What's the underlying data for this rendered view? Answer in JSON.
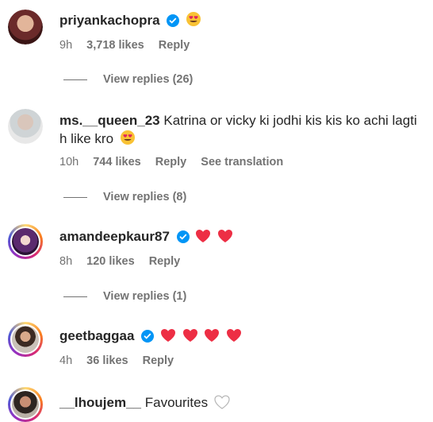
{
  "comments": [
    {
      "username": "priyankachopra",
      "text": "",
      "time": "9h",
      "likes": "3,718 likes",
      "reply": "Reply",
      "view_replies": "View replies (26)"
    },
    {
      "username": "ms.__queen_23",
      "text": "Katrina or vicky ki jodhi kis kis ko achi lagti h like kro",
      "time": "10h",
      "likes": "744 likes",
      "reply": "Reply",
      "translate": "See translation",
      "view_replies": "View replies (8)"
    },
    {
      "username": "amandeepkaur87",
      "text": "",
      "time": "8h",
      "likes": "120 likes",
      "reply": "Reply",
      "view_replies": "View replies (1)"
    },
    {
      "username": "geetbaggaa",
      "text": "",
      "time": "4h",
      "likes": "36 likes",
      "reply": "Reply"
    },
    {
      "username": "__lhoujem__",
      "text": "Favourites"
    }
  ],
  "colors": {
    "verified": "#0095f6",
    "heart": "#ed2e44",
    "meta": "#737373"
  }
}
